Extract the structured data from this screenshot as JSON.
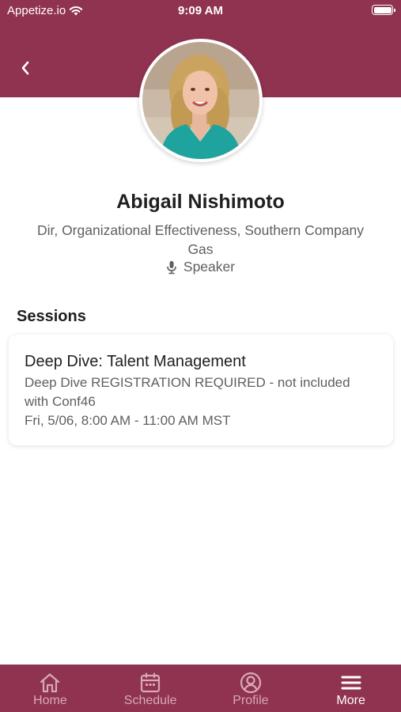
{
  "status_bar": {
    "carrier": "Appetize.io",
    "time": "9:09 AM"
  },
  "speaker": {
    "name": "Abigail Nishimoto",
    "title": "Dir, Organizational Effectiveness, Southern Company Gas",
    "role": "Speaker"
  },
  "sessions": {
    "heading": "Sessions",
    "items": [
      {
        "title": "Deep Dive: Talent Management",
        "description": "Deep Dive REGISTRATION REQUIRED - not included with Conf46",
        "time": "Fri, 5/06, 8:00 AM - 11:00 AM MST"
      }
    ]
  },
  "tab_bar": {
    "tabs": [
      {
        "label": "Home",
        "icon": "home-icon",
        "active": false
      },
      {
        "label": "Schedule",
        "icon": "calendar-icon",
        "active": false
      },
      {
        "label": "Profile",
        "icon": "profile-icon",
        "active": false
      },
      {
        "label": "More",
        "icon": "menu-icon",
        "active": true
      }
    ]
  },
  "colors": {
    "brand": "#8f3350",
    "tab_inactive": "#d8a9b8",
    "text_primary": "#1f1f1f",
    "text_secondary": "#5f5f5f"
  }
}
